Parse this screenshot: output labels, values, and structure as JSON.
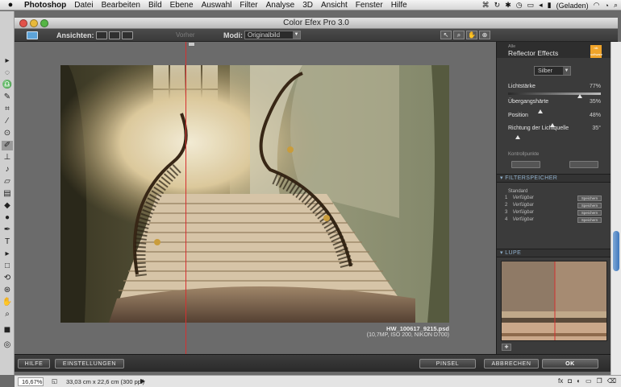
{
  "menubar": {
    "apple": "",
    "app": "Photoshop",
    "items": [
      "Datei",
      "Bearbeiten",
      "Bild",
      "Ebene",
      "Auswahl",
      "Filter",
      "Analyse",
      "3D",
      "Ansicht",
      "Fenster",
      "Hilfe"
    ],
    "battery_label": "(Geladen)"
  },
  "window": {
    "title": "Color Efex Pro 3.0"
  },
  "toolbar": {
    "ansichten_label": "Ansichten:",
    "vorher_label": "Vorher",
    "modi_label": "Modi:",
    "modi_value": "Originalbild"
  },
  "image": {
    "filename": "HW_100617_9215.psd",
    "meta": "(10,7MP, ISO 200, NIKON D700)"
  },
  "filter": {
    "category": "Alle",
    "name": "Reflector Effects",
    "logo_text": "nik software",
    "preset": "Silber",
    "params": [
      {
        "label": "Lichtstärke",
        "value": "77%",
        "fraction": 0.77
      },
      {
        "label": "Übergangshärte",
        "value": "35%",
        "fraction": 0.35
      },
      {
        "label": "Position",
        "value": "48%",
        "fraction": 0.48
      },
      {
        "label": "Richtung der Lichtquelle",
        "value": "35°",
        "fraction": 0.1
      }
    ],
    "control_points_label": "Kontrollpunkte"
  },
  "filterspeicher": {
    "title": "FILTERSPEICHER",
    "standard_label": "Standard",
    "save_label": "Speichern",
    "rows": [
      {
        "num": "1",
        "name": "Verfügbar"
      },
      {
        "num": "2",
        "name": "Verfügbar"
      },
      {
        "num": "3",
        "name": "Verfügbar"
      },
      {
        "num": "4",
        "name": "Verfügbar"
      }
    ]
  },
  "lupe": {
    "title": "LUPE"
  },
  "bottom": {
    "hilfe": "HILFE",
    "einstellungen": "EINSTELLUNGEN",
    "pinsel": "PINSEL",
    "abbrechen": "ABBRECHEN",
    "ok": "OK"
  },
  "status": {
    "zoom": "16,67%",
    "dims": "33,03 cm x 22,6 cm (300 ppi)"
  }
}
